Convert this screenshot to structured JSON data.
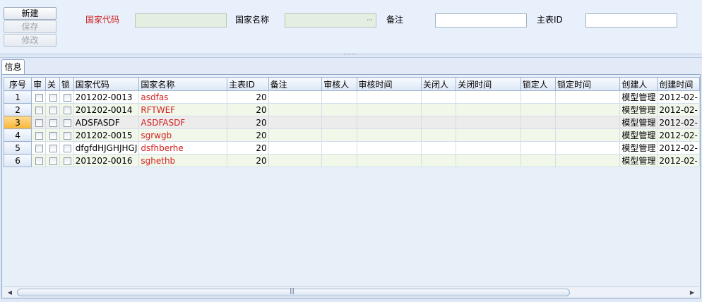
{
  "toolbar": {
    "new_label": "新建",
    "save_label": "保存",
    "edit_label": "修改"
  },
  "form": {
    "country_code_label": "国家代码",
    "country_name_label": "国家名称",
    "remark_label": "备注",
    "master_id_label": "主表ID",
    "country_name_dots": "···"
  },
  "splitter": {
    "grip": "·····"
  },
  "tabs": [
    {
      "label": "信息"
    }
  ],
  "grid": {
    "columns": [
      "序号",
      "审",
      "关",
      "锁",
      "国家代码",
      "国家名称",
      "主表ID",
      "备注",
      "审核人",
      "审核时间",
      "关闭人",
      "关闭时间",
      "锁定人",
      "锁定时间",
      "创建人",
      "创建时间"
    ],
    "rows": [
      {
        "seq": "1",
        "code": "201202-0013",
        "name": "asdfas",
        "master_id": "20",
        "creator": "模型管理",
        "created": "2012-02-"
      },
      {
        "seq": "2",
        "code": "201202-0014",
        "name": "RFTWEF",
        "master_id": "20",
        "creator": "模型管理",
        "created": "2012-02-"
      },
      {
        "seq": "3",
        "code": "ADSFASDF",
        "name": "ASDFASDF",
        "master_id": "20",
        "creator": "模型管理",
        "created": "2012-02-"
      },
      {
        "seq": "4",
        "code": "201202-0015",
        "name": "sgrwgb",
        "master_id": "20",
        "creator": "模型管理",
        "created": "2012-02-"
      },
      {
        "seq": "5",
        "code": "dfgfdHJGHJHGJ",
        "name": "dsfhberhe",
        "master_id": "20",
        "creator": "模型管理",
        "created": "2012-02-"
      },
      {
        "seq": "6",
        "code": "201202-0016",
        "name": "sghethb",
        "master_id": "20",
        "creator": "模型管理",
        "created": "2012-02-"
      }
    ],
    "selected_row": 2
  },
  "scrollbar": {
    "left_arrow": "◀",
    "right_arrow": "▶",
    "grip": "|||"
  },
  "colors": {
    "required_label": "#cc2222",
    "name_text": "#d42020",
    "selected_row_header": "#f7b538"
  }
}
